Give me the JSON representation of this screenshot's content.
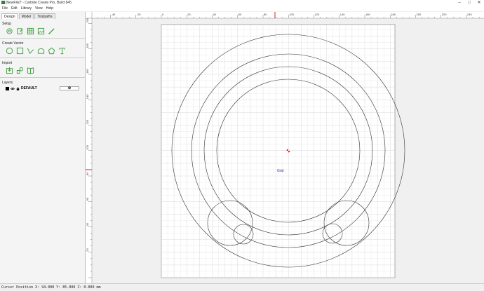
{
  "titlebar": {
    "title": "[NewFile]* - Carbide Create Pro, Build 845",
    "minimize": "–",
    "maximize": "□",
    "close": "✕"
  },
  "menu": {
    "file": "File",
    "edit": "Edit",
    "library": "Library",
    "view": "View",
    "help": "Help"
  },
  "tabs": {
    "design": "Design",
    "model": "Model",
    "toolpaths": "Toolpaths"
  },
  "sections": {
    "setup": "Setup",
    "create_vector": "Create Vector",
    "import": "Import",
    "layers": "Layers"
  },
  "layers": {
    "default_name": "DEFAULT"
  },
  "buttons": {
    "add_layer": "+"
  },
  "ruler": {
    "x_ticks": [
      "-40",
      "-20",
      "0",
      "20",
      "40",
      "60",
      "80",
      "100",
      "120",
      "140",
      "160",
      "180",
      "200",
      "220",
      "240"
    ],
    "y_ticks": [
      "200",
      "180",
      "160",
      "140",
      "120",
      "100",
      "80",
      "60",
      "40",
      "20"
    ]
  },
  "canvas": {
    "grid_label": "Grid"
  },
  "status": {
    "cursor": "Cursor Position X: 94.000 Y: 85.000 Z: 0.000 mm"
  },
  "colors": {
    "accent_green": "#3a9d3a",
    "cursor_marker": "#e02020",
    "grid_label": "#2233aa"
  }
}
